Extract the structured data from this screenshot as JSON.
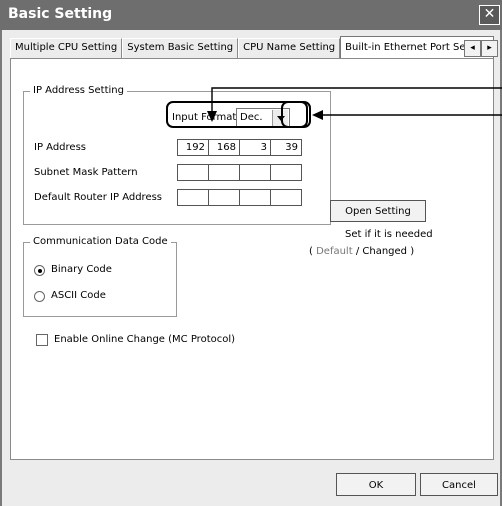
{
  "window": {
    "title": "Basic Setting"
  },
  "tabs": [
    {
      "label": "Multiple CPU Setting",
      "active": false
    },
    {
      "label": "System Basic Setting",
      "active": false
    },
    {
      "label": "CPU Name Setting",
      "active": false
    },
    {
      "label": "Built-in Ethernet Port Setting",
      "active": true
    }
  ],
  "tab_scroll": {
    "left": "◂",
    "right": "▸"
  },
  "ip_group": {
    "title": "IP Address Setting",
    "input_format_label": "Input Format",
    "input_format_value": "Dec.",
    "ip_label": "IP Address",
    "ip_values": [
      "192",
      "168",
      "3",
      "39"
    ],
    "subnet_label": "Subnet Mask Pattern",
    "router_label": "Default Router IP Address"
  },
  "open_setting": {
    "button_label": "Open Setting",
    "note": "Set if it is needed",
    "paren_open": "(",
    "default_label": "Default",
    "slash": "/",
    "changed_label": "Changed",
    "paren_close": ")"
  },
  "comm_group": {
    "title": "Communication Data Code",
    "options": [
      {
        "label": "Binary Code",
        "selected": true
      },
      {
        "label": "ASCII Code",
        "selected": false
      }
    ]
  },
  "online_change": {
    "label": "Enable Online Change (MC Protocol)",
    "checked": false
  },
  "footer": {
    "ok_label": "OK",
    "cancel_label": "Cancel"
  }
}
